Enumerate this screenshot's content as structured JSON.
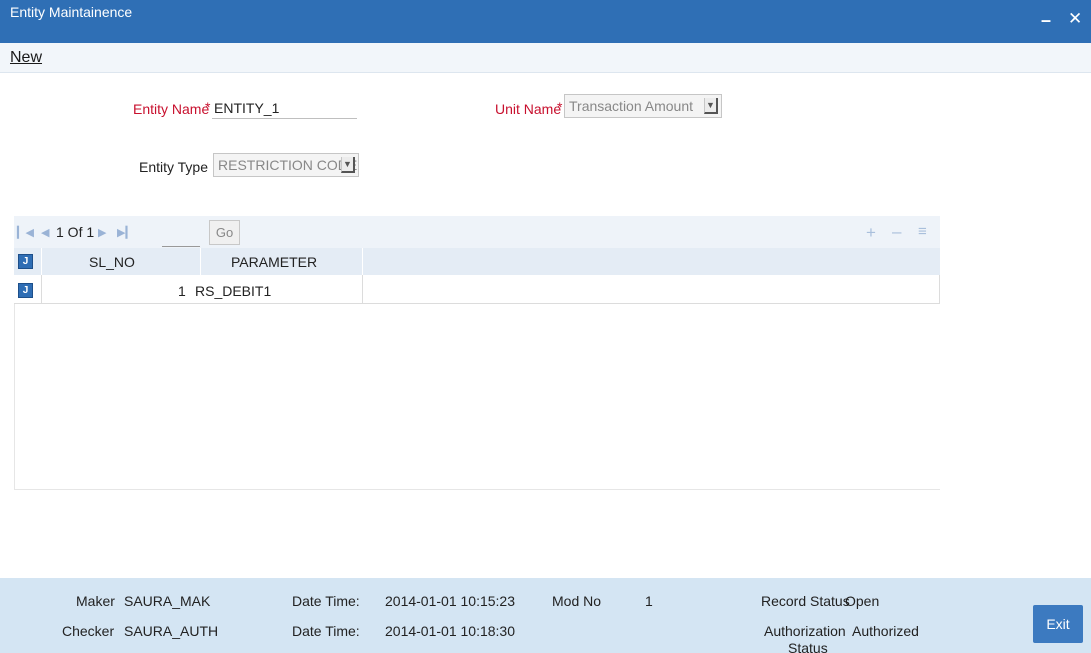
{
  "window": {
    "title": "Entity Maintainence",
    "minimize_icon": "minimize-icon",
    "close_icon": "close-icon"
  },
  "toolbar": {
    "new_label": "New"
  },
  "form": {
    "entity_name_label": "Entity Name",
    "entity_name_value": "ENTITY_1",
    "unit_name_label": "Unit Name",
    "unit_name_value": "Transaction Amount",
    "entity_type_label": "Entity Type",
    "entity_type_value": "RESTRICTION CODE",
    "required_mark": "*"
  },
  "grid": {
    "pagination": {
      "text": "1 Of 1",
      "go_label": "Go",
      "icons": [
        "first-page-icon",
        "prev-page-icon",
        "next-page-icon",
        "last-page-icon"
      ]
    },
    "action_icons": [
      "add-row-icon",
      "delete-row-icon",
      "single-view-icon"
    ],
    "columns": [
      "SL_NO",
      "PARAMETER"
    ],
    "rows": [
      {
        "sl_no": "1",
        "parameter": "RS_DEBIT1"
      }
    ]
  },
  "footer": {
    "maker_label": "Maker",
    "maker_value": "SAURA_MAK",
    "checker_label": "Checker",
    "checker_value": "SAURA_AUTH",
    "date_time_label": "Date Time:",
    "maker_date_time": "2014-01-01 10:15:23",
    "checker_date_time": "2014-01-01 10:18:30",
    "mod_no_label": "Mod No",
    "mod_no_value": "1",
    "record_status_label": "Record Status",
    "record_status_value": "Open",
    "authorization_label": "Authorization",
    "authorization_label_2": "Status",
    "authorization_value": "Authorized",
    "exit_label": "Exit"
  },
  "colors": {
    "titlebar": "#2f6fb5",
    "required": "#c8102e",
    "footer": "#d4e5f3",
    "exit_button": "#3c7ac0"
  }
}
